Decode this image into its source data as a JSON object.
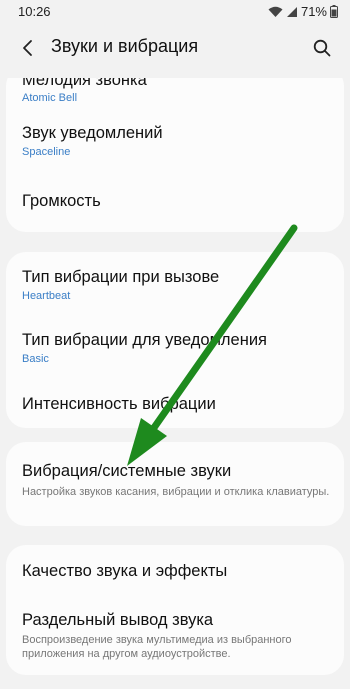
{
  "status_bar": {
    "time": "10:26",
    "battery": "71%",
    "icons": [
      "wifi-icon",
      "cellular-icon",
      "battery-icon"
    ]
  },
  "header": {
    "title": "Звуки и вибрация",
    "back_icon": "back-icon",
    "search_icon": "search-icon"
  },
  "groups": [
    {
      "items": [
        {
          "title": "Мелодия звонка",
          "subtitle": "Atomic Bell"
        },
        {
          "title": "Звук уведомлений",
          "subtitle": "Spaceline"
        },
        {
          "title": "Громкость"
        }
      ]
    },
    {
      "items": [
        {
          "title": "Тип вибрации при вызове",
          "subtitle": "Heartbeat"
        },
        {
          "title": "Тип вибрации для уведомления",
          "subtitle": "Basic"
        },
        {
          "title": "Интенсивность вибрации"
        }
      ]
    },
    {
      "items": [
        {
          "title": "Вибрация/системные звуки",
          "description": "Настройка звуков касания, вибрации и отклика клавиатуры."
        }
      ]
    },
    {
      "items": [
        {
          "title": "Качество звука и эффекты"
        },
        {
          "title": "Раздельный вывод звука",
          "description": "Воспроизведение звука мультимедиа из выбранного приложения на другом аудиоустройстве."
        }
      ]
    }
  ],
  "annotation": {
    "color": "#1e8a1e",
    "icon": "arrow-icon"
  }
}
